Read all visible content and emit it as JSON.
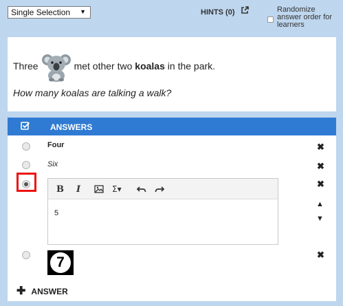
{
  "toolbar": {
    "question_type": "Single Selection",
    "hints_label": "HINTS (0)",
    "randomize_label": "Randomize answer order for learners"
  },
  "question": {
    "line1_before": "Three",
    "line1_after": "met other two",
    "line1_bold": "koalas",
    "line1_end": "in the park.",
    "line2": "How many koalas are talking a walk?"
  },
  "answers": {
    "header": "ANSWERS",
    "items": [
      {
        "text": "Four",
        "style": "bold",
        "selected": false
      },
      {
        "text": "Six",
        "style": "italic",
        "selected": false
      },
      {
        "text": "5",
        "style": "normal",
        "selected": true
      },
      {
        "text": "7",
        "style": "image",
        "selected": false
      }
    ],
    "editor_tools": [
      "B",
      "I",
      "image",
      "Σ▾",
      "undo",
      "redo"
    ],
    "add_label": "ANSWER"
  },
  "colors": {
    "frame_bg": "#bed6ee",
    "header_bg": "#2f7bd3",
    "highlight": "#ee1111"
  }
}
